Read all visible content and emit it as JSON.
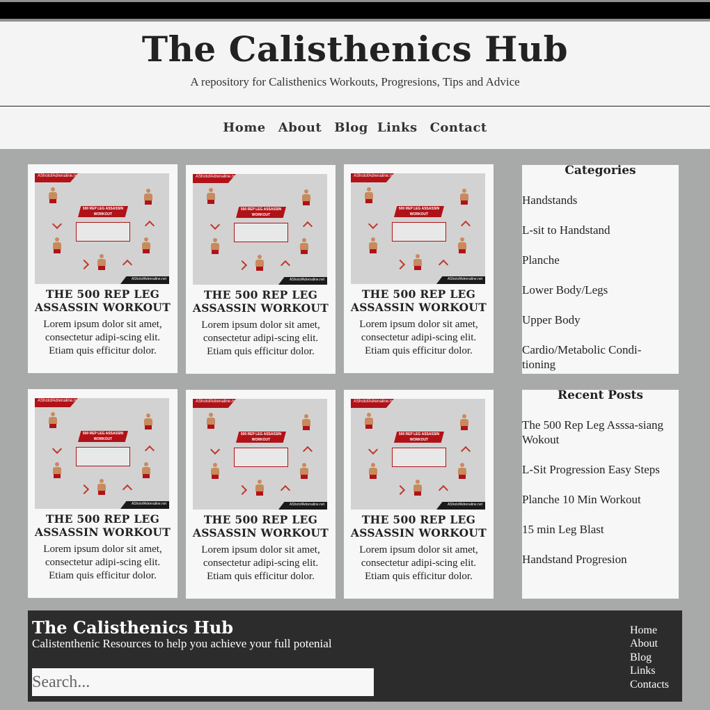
{
  "header": {
    "title": "The Calisthenics Hub",
    "tagline": "A repository for Calisthenics Workouts, Progresions, Tips and Advice"
  },
  "nav": [
    "Home",
    "About",
    "Blog",
    "Links",
    "Contact"
  ],
  "cards": [
    {
      "title": "THE 500 REP LEG ASSASSIN WORKOUT",
      "excerpt": "Lorem ipsum dolor sit amet, consectetur adipi-scing elit. Etiam quis efficitur dolor.",
      "image": {
        "brand": "AShotofAdrenaline.net",
        "banner": "500 REP LEG ASSASSIN WORKOUT",
        "site": "AShotofAdrenaline.net"
      }
    },
    {
      "title": "THE 500 REP LEG ASSASSIN WORKOUT",
      "excerpt": "Lorem ipsum dolor sit amet, consectetur adipi-scing elit. Etiam quis efficitur dolor.",
      "image": {
        "brand": "AShotofAdrenaline.net",
        "banner": "500 REP LEG ASSASSIN WORKOUT",
        "site": "AShotofAdrenaline.net"
      }
    },
    {
      "title": "THE 500 REP LEG ASSASSIN WORKOUT",
      "excerpt": "Lorem ipsum dolor sit amet, consectetur adipi-scing elit. Etiam quis efficitur dolor.",
      "image": {
        "brand": "AShotofAdrenaline.net",
        "banner": "500 REP LEG ASSASSIN WORKOUT",
        "site": "AShotofAdrenaline.net"
      }
    },
    {
      "title": "THE 500 REP LEG ASSASSIN WORKOUT",
      "excerpt": "Lorem ipsum dolor sit amet, consectetur adipi-scing elit. Etiam quis efficitur dolor.",
      "image": {
        "brand": "AShotofAdrenaline.net",
        "banner": "500 REP LEG ASSASSIN WORKOUT",
        "site": "AShotofAdrenaline.net"
      }
    },
    {
      "title": "THE 500 REP LEG ASSASSIN WORKOUT",
      "excerpt": "Lorem ipsum dolor sit amet, consectetur adipi-scing elit. Etiam quis efficitur dolor.",
      "image": {
        "brand": "AShotofAdrenaline.net",
        "banner": "500 REP LEG ASSASSIN WORKOUT",
        "site": "AShotofAdrenaline.net"
      }
    },
    {
      "title": "THE 500 REP LEG ASSASSIN WORKOUT",
      "excerpt": "Lorem ipsum dolor sit amet, consectetur adipi-scing elit. Etiam quis efficitur dolor.",
      "image": {
        "brand": "AShotofAdrenaline.net",
        "banner": "500 REP LEG ASSASSIN WORKOUT",
        "site": "AShotofAdrenaline.net"
      }
    }
  ],
  "sidebar": {
    "categories": {
      "title": "Categories",
      "items": [
        "Handstands",
        "L-sit to Handstand",
        "Planche",
        "Lower Body/Legs",
        "Upper Body",
        "Cardio/Metabolic Condi-tioning"
      ]
    },
    "recent_posts": {
      "title": "Recent Posts",
      "items": [
        "The 500 Rep Leg Asssa-siang  Wokout",
        "L-Sit Progression Easy Steps",
        "Planche 10 Min Workout",
        "15 min Leg Blast",
        "Handstand Progresion"
      ]
    }
  },
  "footer": {
    "title": "The Calisthenics Hub",
    "subtitle": "Calistenthenic Resources to help you achieve your full potenial",
    "search_placeholder": "Search...",
    "nav": [
      "Home",
      "About",
      "Blog",
      "Links",
      "Contacts"
    ]
  },
  "colors": {
    "page_background": "#a8aaa9",
    "header_background": "#f4f4f4",
    "footer_background": "#2d2c2c",
    "accent_red": "#b01217"
  }
}
